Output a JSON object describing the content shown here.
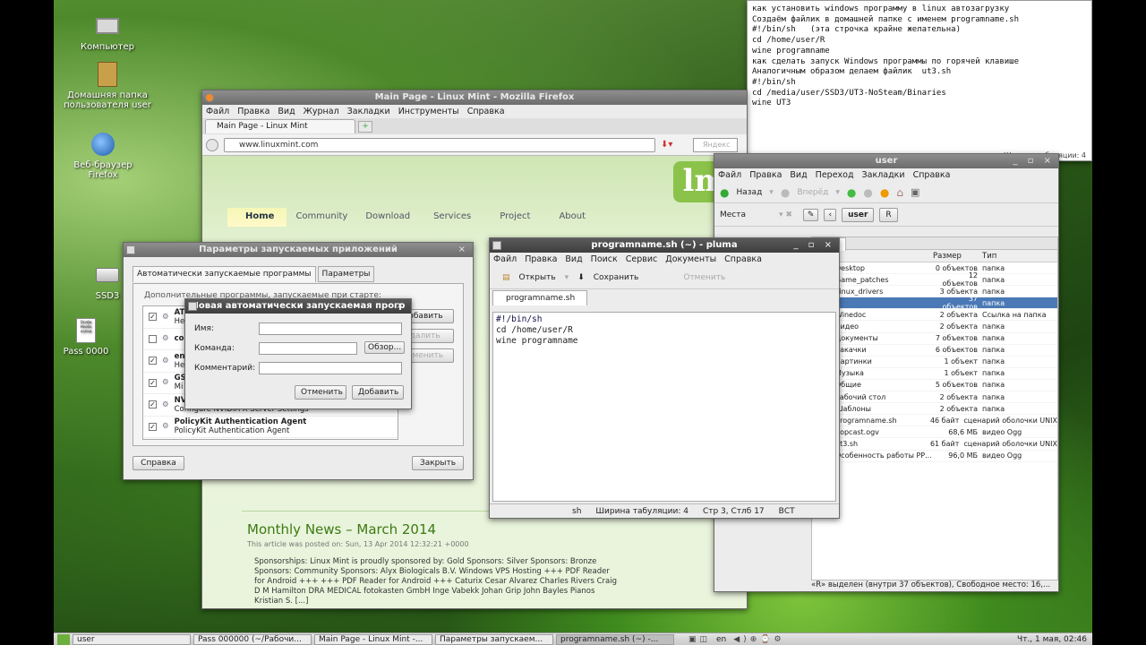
{
  "desktop": {
    "icons": [
      {
        "label": "Компьютер",
        "icon": "computer-icon"
      },
      {
        "label": "Домашняя папка пользователя user",
        "icon": "home-folder-icon"
      },
      {
        "label": "Веб-браузер Firefox",
        "icon": "firefox-icon"
      },
      {
        "label": "SSD3",
        "icon": "drive-icon"
      },
      {
        "label": "Pass 0000",
        "icon": "text-file-icon"
      }
    ]
  },
  "note": {
    "lines": [
      "как установить windows программу в linux автозагрузку",
      "",
      "Создаём файлик в домашней папке с именем programname.sh",
      "#!/bin/sh   (эта строчка крайне желательна)",
      "cd /home/user/R",
      "wine programname",
      "",
      "как сделать запуск Windows программы по горячей клавише",
      "Аналогичным образом делаем файлик  ut3.sh",
      "#!/bin/sh",
      "cd /media/user/SSD3/UT3-NoSteam/Binaries",
      "wine UT3"
    ],
    "status": "Ширина табуляции: 4"
  },
  "firefox": {
    "title": "Main Page - Linux Mint - Mozilla Firefox",
    "menu": [
      "Файл",
      "Правка",
      "Вид",
      "Журнал",
      "Закладки",
      "Инструменты",
      "Справка"
    ],
    "tab": "Main Page - Linux Mint",
    "url": "www.linuxmint.com",
    "search": "Яндекс",
    "logo": "lm",
    "nav": [
      "Home",
      "Community",
      "Download",
      "Services",
      "Project",
      "About"
    ],
    "news_title": "Monthly News – March 2014",
    "news_date": "This article was posted on: Sun, 13 Apr 2014 12:32:21 +0000",
    "news_body": "Sponsorships: Linux Mint is proudly sponsored by: Gold Sponsors: Silver Sponsors: Bronze Sponsors: Community Sponsors: Alyx Biologicals B.V. Windows VPS Hosting +++ PDF Reader for Android +++ +++ PDF Reader for Android +++ Caturix Cesar Alvarez Charles Rivers Craig D M Hamilton DRA MEDICAL fotokasten GmbH Inge Vabekk Johan Grip John Bayles Pianos Kristian S. [...]"
  },
  "startup": {
    "title": "Параметры запускаемых приложений",
    "tabs": [
      "Автоматически запускаемые программы",
      "Параметры"
    ],
    "intro": "Дополнительные программы, запускаемые при старте:",
    "items": [
      {
        "checked": true,
        "name": "AT",
        "desc": "Не"
      },
      {
        "checked": false,
        "name": "со",
        "desc": ""
      },
      {
        "checked": true,
        "name": "en",
        "desc": "Не"
      },
      {
        "checked": true,
        "name": "GS",
        "desc": "Mi"
      },
      {
        "checked": true,
        "name": "NVIDIA X Server Settings",
        "desc": "Configure NVIDIA X Server Settings"
      },
      {
        "checked": true,
        "name": "PolicyKit Authentication Agent",
        "desc": "PolicyKit Authentication Agent"
      }
    ],
    "add": "Добавить",
    "remove": "Удалить",
    "edit": "Изменить",
    "help": "Справка",
    "close": "Закрыть"
  },
  "newapp": {
    "title": "Новая автоматически запускаемая прогр",
    "name_label": "Имя:",
    "command_label": "Команда:",
    "comment_label": "Комментарий:",
    "browse": "Обзор...",
    "cancel": "Отменить",
    "add": "Добавить"
  },
  "pluma": {
    "title": "programname.sh (~) - pluma",
    "menu": [
      "Файл",
      "Правка",
      "Вид",
      "Поиск",
      "Сервис",
      "Документы",
      "Справка"
    ],
    "open": "Открыть",
    "save": "Сохранить",
    "cancel": "Отменить",
    "tab": "programname.sh",
    "code": [
      "#!/bin/sh",
      "cd /home/user/R",
      "wine programname"
    ],
    "lang": "sh",
    "tabwidth": "Ширина табуляции:  4",
    "pos": "Стр 3, Стлб 17",
    "mode": "ВСТ"
  },
  "fm": {
    "title": "user",
    "menu": [
      "Файл",
      "Правка",
      "Вид",
      "Переход",
      "Закладки",
      "Справка"
    ],
    "back": "Назад",
    "forward": "Вперёд",
    "places": "Места",
    "crumb": "user",
    "crumb2": "R",
    "tab": "user",
    "cols": [
      "Размер",
      "Тип"
    ],
    "rows": [
      {
        "name": "Desktop",
        "size": "0 объектов",
        "type": "папка"
      },
      {
        "name": "Game_patches",
        "size": "12 объектов",
        "type": "папка"
      },
      {
        "name": "Linux_drivers",
        "size": "3 объекта",
        "type": "папка"
      },
      {
        "name": "R",
        "size": "37 объектов",
        "type": "папка",
        "sel": true
      },
      {
        "name": "Winedoc",
        "size": "2 объекта",
        "type": "Ссылка на папка"
      },
      {
        "name": "Видео",
        "size": "2 объекта",
        "type": "папка"
      },
      {
        "name": "Документы",
        "size": "7 объектов",
        "type": "папка"
      },
      {
        "name": "Закачки",
        "size": "6 объектов",
        "type": "папка"
      },
      {
        "name": "Картинки",
        "size": "1 объект",
        "type": "папка"
      },
      {
        "name": "Музыка",
        "size": "1 объект",
        "type": "папка"
      },
      {
        "name": "Общие",
        "size": "5 объектов",
        "type": "папка"
      },
      {
        "name": "Рабочий стол",
        "size": "2 объекта",
        "type": "папка"
      },
      {
        "name": "Шаблоны",
        "size": "2 объекта",
        "type": "папка"
      },
      {
        "name": "programname.sh",
        "size": "46 байт",
        "type": "сценарий оболочки UNIX"
      },
      {
        "name": "popcast.ogv",
        "size": "68,6 МБ",
        "type": "видео Ogg"
      },
      {
        "name": "ut3.sh",
        "size": "61 байт",
        "type": "сценарий оболочки UNIX"
      },
      {
        "name": "Особенность работы РР...",
        "size": "96,0 МБ",
        "type": "видео Ogg"
      }
    ],
    "status": "«R» выделен (внутри 37 объектов), Свободное место: 16,..."
  },
  "taskbar": {
    "items": [
      "user",
      "Pass 000000 (~/Рабочи...",
      "Main Page - Linux Mint -...",
      "Параметры запускаем...",
      "programname.sh (~) -..."
    ],
    "lang": "en",
    "clock": "Чт.,  1 мая, 02:46"
  }
}
